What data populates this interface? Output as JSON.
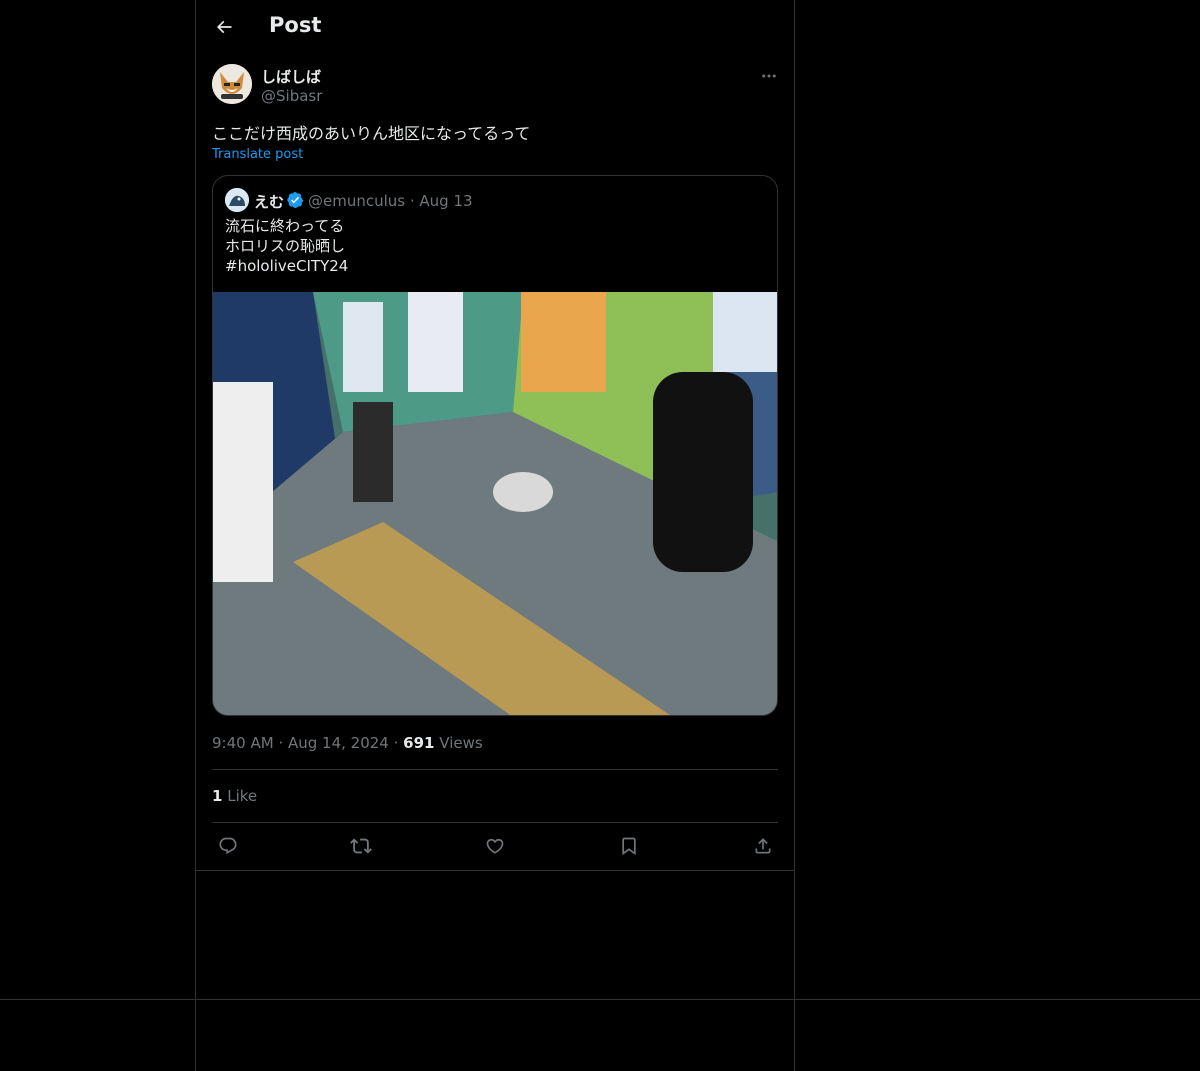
{
  "header": {
    "title": "Post"
  },
  "author": {
    "name": "しばしば",
    "handle": "@Sibasr"
  },
  "post": {
    "text": "ここだけ西成のあいりん地区になってるって",
    "translate_label": "Translate post"
  },
  "quote": {
    "name": "えむ",
    "handle_date": "@emunculus · Aug 13",
    "lines": [
      "流石に終わってる",
      "ホロリスの恥晒し",
      "#hololiveCITY24"
    ]
  },
  "meta": {
    "time": "9:40 AM",
    "date": "Aug 14, 2024",
    "views_count": "691",
    "views_label": "Views"
  },
  "likes": {
    "count": "1",
    "label": "Like"
  },
  "icons": [
    "back-arrow-icon",
    "more-icon",
    "verified-badge-icon",
    "reply-icon",
    "repost-icon",
    "like-icon",
    "bookmark-icon",
    "share-icon"
  ],
  "colors": {
    "background": "#000000",
    "border": "#2f3336",
    "text": "#e7e9ea",
    "muted": "#71767b",
    "accent": "#1d9bf0"
  }
}
